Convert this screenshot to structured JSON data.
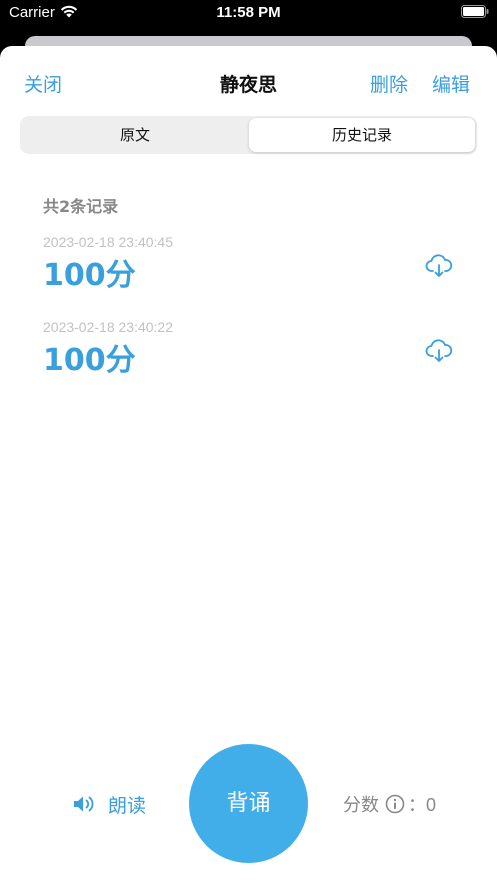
{
  "status_bar": {
    "carrier": "Carrier",
    "time": "11:58 PM",
    "wifi_icon": "wifi-icon",
    "battery_icon": "battery-icon"
  },
  "nav": {
    "close_label": "关闭",
    "title": "静夜思",
    "delete_label": "删除",
    "edit_label": "编辑"
  },
  "segments": {
    "original_label": "原文",
    "history_label": "历史记录",
    "selected": "历史记录"
  },
  "history": {
    "count_label": "共2条记录",
    "records": [
      {
        "datetime": "2023-02-18 23:40:45",
        "score": "100分",
        "icon": "cloud-download-icon"
      },
      {
        "datetime": "2023-02-18 23:40:22",
        "score": "100分",
        "icon": "cloud-download-icon"
      }
    ]
  },
  "bottom": {
    "read_aloud_label": "朗读",
    "recite_label": "背诵",
    "score_label": "分数",
    "score_colon": "：",
    "score_value": "0",
    "speaker_icon": "speaker-icon",
    "info_icon": "info-icon"
  },
  "colors": {
    "accent": "#3a9fdd",
    "recite_button": "#41aeea",
    "secondary_text": "#888888",
    "date_text": "#c2c2c4"
  }
}
